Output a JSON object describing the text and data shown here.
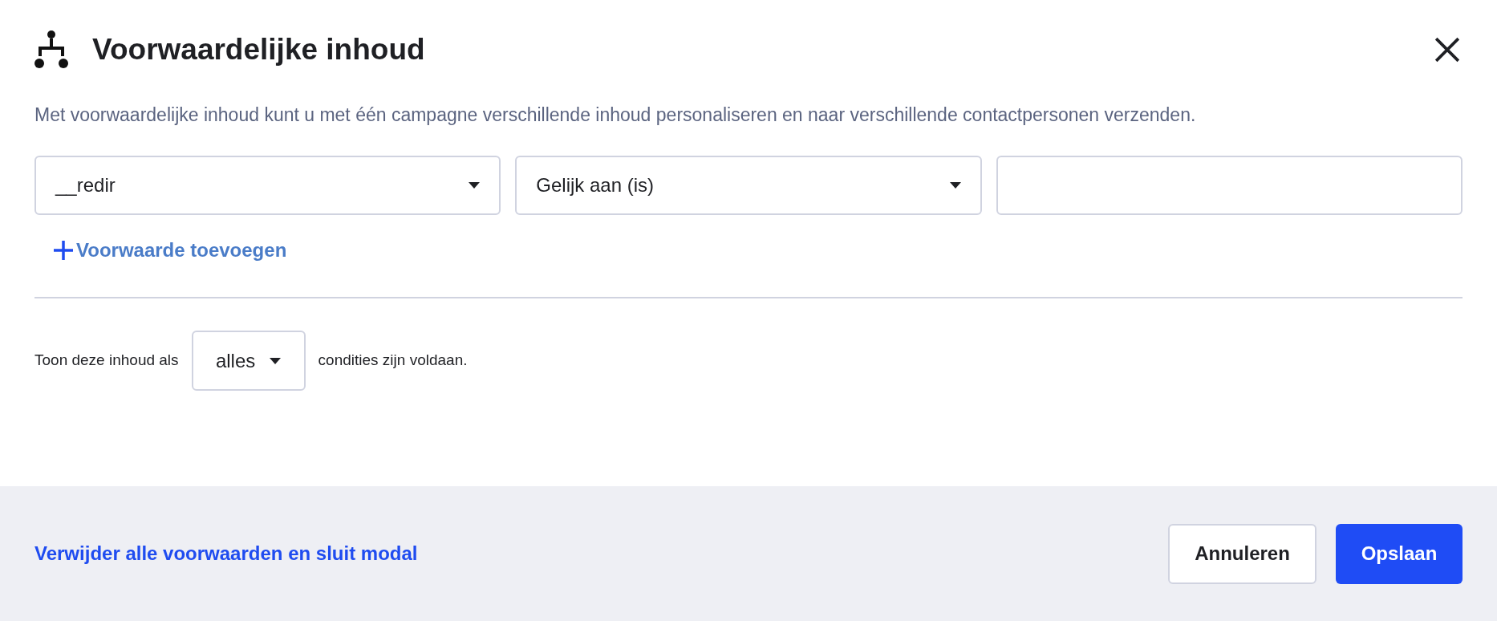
{
  "modal": {
    "title": "Voorwaardelijke inhoud",
    "description": "Met voorwaardelijke inhoud kunt u met één campagne verschillende inhoud personaliseren en naar verschillende contactpersonen verzenden.",
    "condition_fields": [
      {
        "kind": "select",
        "value": "__redir"
      },
      {
        "kind": "select",
        "value": "Gelijk aan (is)"
      },
      {
        "kind": "input"
      }
    ],
    "add_condition": {
      "label": "Voorwaarde toevoegen"
    },
    "match_rule": {
      "prefix": "Toon deze inhoud als",
      "value": "alles",
      "suffix": "condities zijn voldaan."
    },
    "footer": {
      "remove_link": "Verwijder alle voorwaarden en sluit modal",
      "buttons": [
        {
          "kind": "secondary",
          "label": "Annuleren"
        },
        {
          "kind": "primary",
          "label": "Opslaan"
        }
      ]
    }
  }
}
